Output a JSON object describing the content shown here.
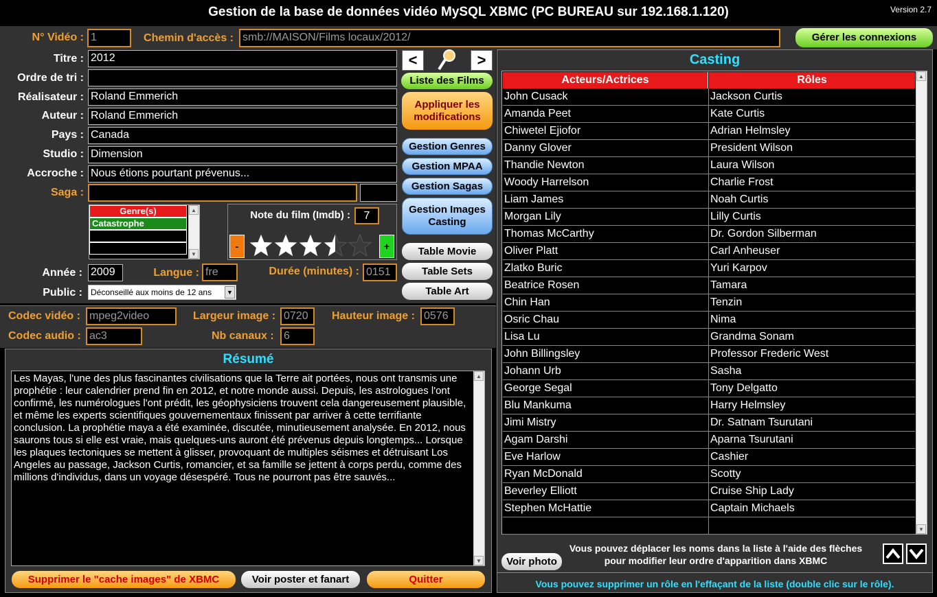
{
  "window": {
    "title": "Gestion de la base de données vidéo MySQL XBMC (PC BUREAU sur 192.168.1.120)",
    "version": "Version 2.7"
  },
  "top": {
    "video_no_label": "N° Vidéo :",
    "video_no": "1",
    "path_label": "Chemin d'accès :",
    "path": "smb://MAISON/Films locaux/2012/",
    "connections_btn": "Gérer les connexions"
  },
  "form": {
    "titre_label": "Titre :",
    "titre": "2012",
    "ordre_label": "Ordre de tri :",
    "ordre": "",
    "realisateur_label": "Réalisateur :",
    "realisateur": "Roland Emmerich",
    "auteur_label": "Auteur :",
    "auteur": "Roland Emmerich",
    "pays_label": "Pays :",
    "pays": "Canada",
    "studio_label": "Studio :",
    "studio": "Dimension",
    "accroche_label": "Accroche :",
    "accroche": "Nous étions pourtant prévenus...",
    "saga_label": "Saga :",
    "saga": "",
    "saga_no": "",
    "genres_header": "Genre(s)",
    "genres": [
      "Catastrophe",
      "",
      ""
    ],
    "note_label": "Note du film (Imdb) :",
    "note": "7",
    "rating_stars": 3.5,
    "minus": "-",
    "plus": "+",
    "annee_label": "Année :",
    "annee": "2009",
    "langue_label": "Langue :",
    "langue": "fre",
    "duree_label": "Durée (minutes) :",
    "duree": "0151",
    "public_label": "Public :",
    "public": "Déconseillé aux moins de 12 ans"
  },
  "nav": {
    "prev": "<",
    "next": ">",
    "search_icon": "magnifier-icon"
  },
  "actions": {
    "liste_films": "Liste des Films",
    "appliquer": "Appliquer les modifications",
    "genres": "Gestion Genres",
    "mpaa": "Gestion MPAA",
    "sagas": "Gestion Sagas",
    "images_casting": "Gestion Images Casting",
    "table_movie": "Table Movie",
    "table_sets": "Table Sets",
    "table_art": "Table Art"
  },
  "codec": {
    "video_label": "Codec vidéo :",
    "video": "mpeg2video",
    "largeur_label": "Largeur image :",
    "largeur": "0720",
    "hauteur_label": "Hauteur image :",
    "hauteur": "0576",
    "audio_label": "Codec audio :",
    "audio": "ac3",
    "canaux_label": "Nb canaux :",
    "canaux": "6"
  },
  "resume": {
    "title": "Résumé",
    "text": "Les Mayas, l'une des plus fascinantes civilisations que la Terre ait portées, nous ont transmis une prophétie : leur calendrier prend fin en 2012, et notre monde aussi. Depuis, les astrologues l'ont confirmé, les numérologues l'ont prédit, les géophysiciens trouvent cela dangereusement plausible, et même les experts scientifiques gouvernementaux finissent par arriver à cette terrifiante conclusion. La prophétie maya a été examinée, discutée, minutieusement analysée. En 2012, nous saurons tous si elle est vraie, mais quelques-uns auront été prévenus depuis longtemps... Lorsque les plaques tectoniques se mettent à glisser, provoquant de multiples séismes et détruisant Los Angeles au passage, Jackson Curtis, romancier, et sa famille se jettent à corps perdu, comme des millions d'individus, dans un voyage désespéré. Tous ne pourront pas être sauvés..."
  },
  "bottom": {
    "cache_btn": "Supprimer le \"cache images\" de XBMC",
    "poster_btn": "Voir poster et fanart",
    "quit_btn": "Quitter"
  },
  "casting": {
    "title": "Casting",
    "col_actor": "Acteurs/Actrices",
    "col_role": "Rôles",
    "rows": [
      {
        "actor": "John Cusack",
        "role": "Jackson Curtis"
      },
      {
        "actor": "Amanda Peet",
        "role": "Kate Curtis"
      },
      {
        "actor": "Chiwetel Ejiofor",
        "role": "Adrian Helmsley"
      },
      {
        "actor": "Danny Glover",
        "role": "President Wilson"
      },
      {
        "actor": "Thandie Newton",
        "role": "Laura Wilson"
      },
      {
        "actor": "Woody Harrelson",
        "role": "Charlie Frost"
      },
      {
        "actor": "Liam James",
        "role": "Noah Curtis"
      },
      {
        "actor": "Morgan Lily",
        "role": "Lilly Curtis"
      },
      {
        "actor": "Thomas McCarthy",
        "role": "Dr. Gordon Silberman"
      },
      {
        "actor": "Oliver Platt",
        "role": "Carl Anheuser"
      },
      {
        "actor": "Zlatko Buric",
        "role": "Yuri Karpov"
      },
      {
        "actor": "Beatrice Rosen",
        "role": "Tamara"
      },
      {
        "actor": "Chin Han",
        "role": "Tenzin"
      },
      {
        "actor": "Osric Chau",
        "role": "Nima"
      },
      {
        "actor": "Lisa Lu",
        "role": "Grandma Sonam"
      },
      {
        "actor": "John Billingsley",
        "role": "Professor Frederic West"
      },
      {
        "actor": "Johann Urb",
        "role": "Sasha"
      },
      {
        "actor": "George Segal",
        "role": "Tony Delgatto"
      },
      {
        "actor": "Blu Mankuma",
        "role": "Harry Helmsley"
      },
      {
        "actor": "Jimi Mistry",
        "role": "Dr. Satnam Tsurutani"
      },
      {
        "actor": "Agam Darshi",
        "role": "Aparna Tsurutani"
      },
      {
        "actor": "Eve Harlow",
        "role": "Cashier"
      },
      {
        "actor": "Ryan McDonald",
        "role": "Scotty"
      },
      {
        "actor": "Beverley Elliott",
        "role": "Cruise Ship Lady"
      },
      {
        "actor": "Stephen McHattie",
        "role": "Captain Michaels"
      },
      {
        "actor": "",
        "role": ""
      }
    ],
    "voir_photo": "Voir photo",
    "move_help": "Vous pouvez déplacer les noms dans la liste à l'aide des flèches pour modifier leur ordre d'apparition dans XBMC",
    "delete_help": "Vous pouvez supprimer un rôle en l'effaçant de la liste (double clic sur le rôle)."
  }
}
